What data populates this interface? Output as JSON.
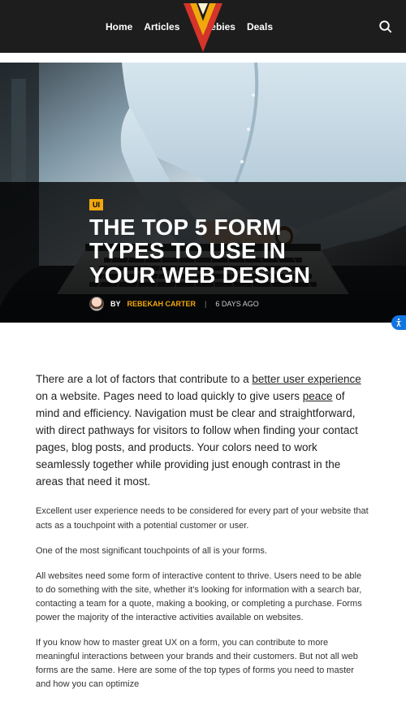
{
  "nav": {
    "home": "Home",
    "articles": "Articles",
    "freebies": "Freebies",
    "deals": "Deals"
  },
  "hero": {
    "category": "UI",
    "title": "THE TOP 5 FORM TYPES TO USE IN YOUR WEB DESIGN",
    "by_prefix": "BY",
    "author": "REBEKAH CARTER",
    "separator": "|",
    "date": "6 DAYS AGO"
  },
  "article": {
    "lead_pre": "There are a lot of factors that contribute to a ",
    "lead_link1": "better user experience",
    "lead_mid": " on a website. Pages need to load quickly to give users ",
    "lead_link2": "peace",
    "lead_post": " of mind and efficiency. Navigation must be clear and straightforward, with direct pathways for visitors to follow when finding your contact pages, blog posts, and products. Your colors need to work seamlessly together while providing just enough contrast in the areas that need it most.",
    "p2": "Excellent user experience needs to be considered for every part of your website that acts as a touchpoint with a potential customer or user.",
    "p3": "One of the most significant touchpoints of all is your forms.",
    "p4": "All websites need some form of interactive content to thrive. Users need to be able to do something with the site, whether it's looking for information with a search bar, contacting a team for a quote, making a booking, or completing a purchase. Forms power the majority of the interactive activities available on websites.",
    "p5": "If you know how to master great UX on a form, you can contribute to more meaningful interactions between your brands and their customers. But not all web forms are the same. Here are some of the top types of forms you need to master and how you can optimize"
  }
}
